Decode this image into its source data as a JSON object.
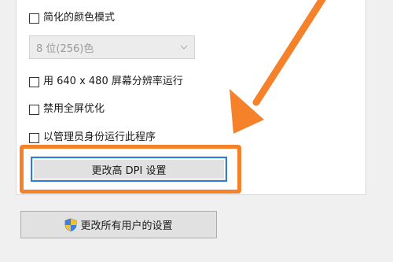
{
  "compatibility_settings": {
    "reduced_color_mode": {
      "label": "简化的颜色模式",
      "checked": false
    },
    "color_depth_select": {
      "value": "8 位(256)色",
      "enabled": false
    },
    "run_640x480": {
      "label": "用 640 x 480 屏幕分辨率运行",
      "checked": false
    },
    "disable_fullscreen_optimizations": {
      "label": "禁用全屏优化",
      "checked": false
    },
    "run_as_admin": {
      "label": "以管理员身份运行此程序",
      "checked": false
    },
    "change_high_dpi_button": {
      "label": "更改高 DPI 设置"
    }
  },
  "footer": {
    "change_all_users_button": {
      "label": "更改所有用户的设置",
      "icon": "uac-shield-icon"
    }
  },
  "annotation": {
    "color": "#f5822a",
    "target": "change_high_dpi_button"
  }
}
